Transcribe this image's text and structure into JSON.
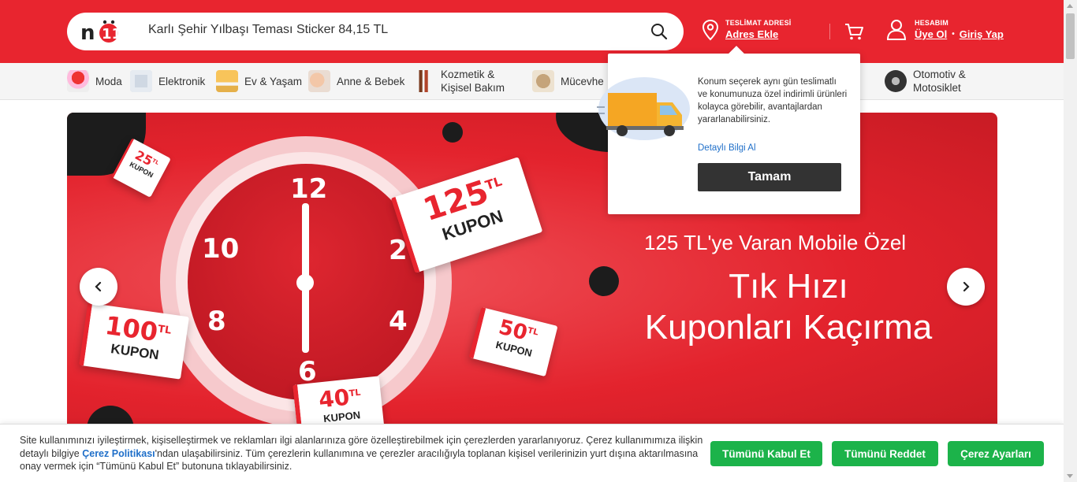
{
  "header": {
    "logo": "n11",
    "search": {
      "value": "Karlı Şehir Yılbaşı Teması Sticker 84,15 TL"
    },
    "delivery": {
      "caption": "TESLİMAT ADRESİ",
      "link": "Adres Ekle"
    },
    "account": {
      "caption": "HESABIM",
      "signup": "Üye Ol",
      "separator": "•",
      "login": "Giriş Yap"
    }
  },
  "categories": [
    {
      "label": "Moda",
      "icon": "fashion-icon"
    },
    {
      "label": "Elektronik",
      "icon": "electronics-icon"
    },
    {
      "label": "Ev & Yaşam",
      "icon": "home-icon"
    },
    {
      "label": "Anne & Bebek",
      "icon": "baby-icon"
    },
    {
      "label": "Kozmetik &",
      "label2": "Kişisel Bakım",
      "icon": "cosmetics-icon"
    },
    {
      "label": "Mücevhe",
      "icon": "jewelry-icon"
    },
    {
      "label": "Otomotiv &",
      "label2": "Motosiklet",
      "icon": "tire-icon"
    }
  ],
  "hero": {
    "tagline": "125 TL'ye Varan Mobile Özel",
    "headline_line1": "Tık Hızı",
    "headline_line2": "Kuponları Kaçırma",
    "clock_numbers": {
      "n12": "12",
      "n2": "2",
      "n4": "4",
      "n6": "6",
      "n8": "8",
      "n10": "10"
    },
    "tickets": {
      "t125": {
        "amount": "125",
        "unit": "TL",
        "word": "KUPON"
      },
      "t100": {
        "amount": "100",
        "unit": "TL",
        "word": "KUPON"
      },
      "t50": {
        "amount": "50",
        "unit": "TL",
        "word": "KUPON"
      },
      "t40": {
        "amount": "40",
        "unit": "TL",
        "word": "KUPON"
      },
      "t25": {
        "amount": "25",
        "unit": "TL",
        "word": "KUPON"
      }
    }
  },
  "popover": {
    "message": "Konum seçerek aynı gün teslimatlı ve konumunuza özel indirimli ürünleri kolayca görebilir, avantajlardan yararlanabilirsiniz.",
    "more_link": "Detaylı Bilgi Al",
    "ok_button": "Tamam"
  },
  "cookie": {
    "text_before": "Site kullanımınızı iyileştirmek, kişiselleştirmek ve reklamları ilgi alanlarınıza göre özelleştirebilmek için çerezlerden yararlanıyoruz. Çerez kullanımımıza ilişkin detaylı bilgiye ",
    "link": "Çerez Politikası",
    "text_after": "'ndan ulaşabilirsiniz. Tüm çerezlerin kullanımına ve çerezler aracılığıyla toplanan kişisel verilerinizin yurt dışına aktarılmasına onay vermek için “Tümünü Kabul Et” butonuna tıklayabilirsiniz.",
    "accept_all": "Tümünü Kabul Et",
    "reject_all": "Tümünü Reddet",
    "settings": "Çerez Ayarları"
  },
  "colors": {
    "brand": "#e8252f",
    "dark": "#333333",
    "green": "#1cb34a",
    "link": "#1f6fc9"
  }
}
